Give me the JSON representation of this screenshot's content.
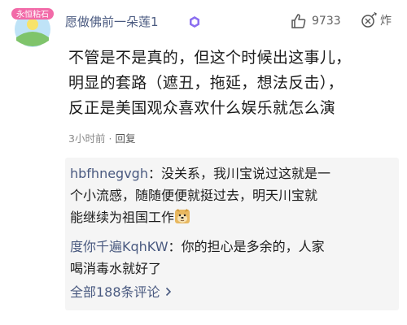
{
  "comment": {
    "avatar_badge_text": "永恒粘石",
    "username": "愿做佛前一朵莲1",
    "like_count": "9733",
    "zha_label": "炸",
    "content_lines": [
      "不管是不是真的，但这个时候出这事儿，",
      "明显的套路（遮丑，拖延，想法反击），",
      "反正是美国观众喜欢什么娱乐就怎么演"
    ],
    "time": "3小时前",
    "separator": "·",
    "reply_label": "回复"
  },
  "replies": [
    {
      "name": "hbfhnegvgh",
      "colon": "：",
      "text_lines": [
        "没关系，我川宝说过这就是一",
        "个小流感，随随便便就挺过去，明天川宝就",
        "能继续为祖国工作"
      ],
      "emoji": "doge-emoji"
    },
    {
      "name": "度你千遍KqhKW",
      "colon": "：",
      "text_lines": [
        "你的担心是多余的，人家",
        "喝消毒水就好了"
      ]
    }
  ],
  "all_comments_label": "全部188条评论",
  "colors": {
    "username": "#4a5a80",
    "reply_bg": "#f5f5f5",
    "meta": "#8a8a8a"
  }
}
